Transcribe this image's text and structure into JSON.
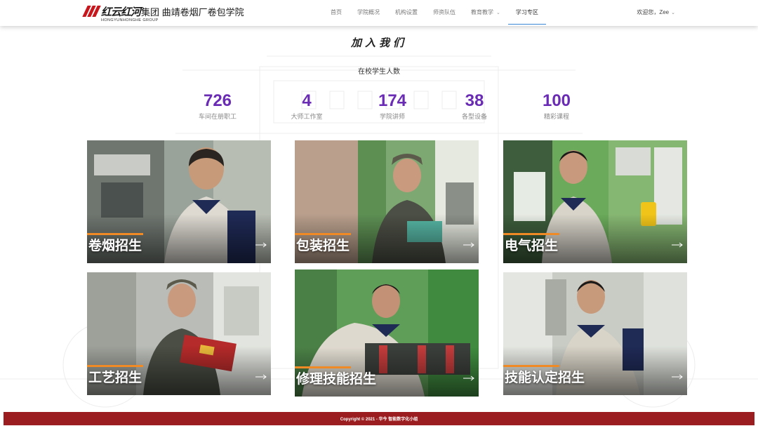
{
  "header": {
    "logo_script": "红云红河",
    "logo_text": "集团 曲靖卷烟厂卷包学院",
    "logo_sub": "HONGYUNHONGHE GROUP",
    "nav": [
      {
        "label": "首页"
      },
      {
        "label": "学院概况"
      },
      {
        "label": "机构设置"
      },
      {
        "label": "师资队伍"
      },
      {
        "label": "教育教学"
      },
      {
        "label": "学习专区"
      }
    ],
    "user": "欢迎您，Zee"
  },
  "main": {
    "title": "加入我们",
    "students_label": "在校学生人数",
    "stats": [
      {
        "value": "726",
        "label": "车间在册职工"
      },
      {
        "value": "4",
        "label": "大师工作室"
      },
      {
        "value": "174",
        "label": "学院讲师"
      },
      {
        "value": "38",
        "label": "各型设备"
      },
      {
        "value": "100",
        "label": "精彩课程"
      }
    ],
    "cards": [
      {
        "title": "卷烟招生",
        "photo_icon": "worker-at-machine"
      },
      {
        "title": "包装招生",
        "photo_icon": "worker-packaging-line"
      },
      {
        "title": "电气招生",
        "photo_icon": "electrician-with-multimeter"
      },
      {
        "title": "工艺招生",
        "photo_icon": "worker-holding-cigarette-pack"
      },
      {
        "title": "修理技能招生",
        "photo_icon": "mechanic-repairing-rollers"
      },
      {
        "title": "技能认定招生",
        "photo_icon": "worker-inspecting-parts"
      }
    ]
  },
  "footer": {
    "text": "Copyright © 2021 - 华今 智能数字化小组"
  },
  "colors": {
    "accent_purple": "#6a2bb5",
    "footer_red": "#9c1d1f",
    "title_bar_orange": "#f08a24",
    "nav_active_underline": "#3a86d6"
  }
}
